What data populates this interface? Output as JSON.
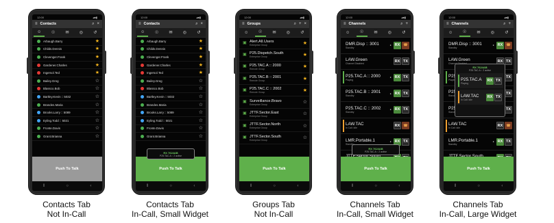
{
  "status_time": "12:00",
  "menu_icon": "menu-icon",
  "search_icon": "search-icon",
  "add_icon": "add-icon",
  "close_icon": "close-icon",
  "tab_icons": [
    "person-icon",
    "radio-icon",
    "message-icon",
    "globe-icon",
    "history-icon"
  ],
  "ptt_label": "Push To Talk",
  "contacts": [
    {
      "name": "Arbaugh.Barry",
      "color": "#4caf50",
      "fav": true
    },
    {
      "name": "Childs.Dennis",
      "color": "#4caf50",
      "fav": true
    },
    {
      "name": "Clevenger.Frank",
      "color": "#4caf50",
      "fav": true
    },
    {
      "name": "Gardener.Charles",
      "color": "#e53935",
      "fav": true
    },
    {
      "name": "Ingersol.Ted",
      "color": "#e53935",
      "fav": true
    },
    {
      "name": "Bailey.Greg",
      "color": "#4caf50",
      "fav": false
    },
    {
      "name": "Blassco.Bob",
      "color": "#e53935",
      "fav": false
    },
    {
      "name": "Bartley.Kevin :: 5032",
      "color": "#42a5f5",
      "fav": false
    },
    {
      "name": "Brandes.Maria",
      "color": "#4caf50",
      "fav": false
    },
    {
      "name": "Brooks.Larry :: 5089",
      "color": "#42a5f5",
      "fav": false
    },
    {
      "name": "Eyling.Todd :: 5021",
      "color": "#42a5f5",
      "fav": false
    },
    {
      "name": "Fronte.Davis",
      "color": "#4caf50",
      "fav": false
    },
    {
      "name": "Grant.Brianna",
      "color": "#4caf50",
      "fav": false
    }
  ],
  "groups": [
    {
      "name": "Alert.All.Users",
      "sub": "Enterprise Group",
      "fav": true
    },
    {
      "name": "P25.Dispetch.South",
      "sub": "Enterprise Group",
      "fav": true
    },
    {
      "name": "P25.TAC.A :: 2000",
      "sub": "Remote Group",
      "fav": true
    },
    {
      "name": "P25.TAC.B :: 2001",
      "sub": "Remote Group",
      "fav": true
    },
    {
      "name": "P25.TAC.C :: 2002",
      "sub": "Remote Group",
      "fav": true
    },
    {
      "name": "Surveillance.Bravo",
      "sub": "Enterprise Group",
      "fav": false
    },
    {
      "name": "JTTF.Sector.East",
      "sub": "Enterprise Group",
      "fav": false
    },
    {
      "name": "JTTF.Sector.North",
      "sub": "Enterprise Group",
      "fav": false
    },
    {
      "name": "JTTF.Sector.South",
      "sub": "Enterprise Group",
      "fav": false
    }
  ],
  "channels": [
    {
      "name": "DMR.Disp :: 3001",
      "status": "Standby",
      "bar": "",
      "rx": "on",
      "mon": "●",
      "emg": true
    },
    {
      "name": "LAW.Green",
      "status": "Channel Disabled",
      "bar": "",
      "rx": "off",
      "mon": "",
      "emg": false
    },
    {
      "name": "P25.TAC.A :: 2000",
      "status": "Playing",
      "bar": "#5fb04b",
      "rx": "on",
      "mon": "●",
      "emg": false
    },
    {
      "name": "P25.TAC.B :: 2001",
      "status": "Standby",
      "bar": "",
      "rx": "on",
      "mon": "●",
      "emg": false
    },
    {
      "name": "P25.TAC.C :: 2002",
      "status": "Standby",
      "bar": "",
      "rx": "on",
      "mon": "●",
      "emg": false
    },
    {
      "name": "LAW.TAC",
      "status": "In Call: Idle",
      "bar": "#f0a030",
      "rx": "off",
      "mon": "",
      "emg": true
    },
    {
      "name": "LMR.Portable.1",
      "status": "Standby",
      "bar": "",
      "rx": "on",
      "mon": "●",
      "emg": false
    },
    {
      "name": "JTTF.Sector.South",
      "status": "Standby",
      "bar": "",
      "rx": "on",
      "mon": "",
      "emg": false
    }
  ],
  "rx_label": "RX",
  "tx_label": "TX",
  "small_widget": {
    "line1": "RX 7624AB",
    "line2": "P25.TAC.A :: 2 active"
  },
  "large_widget": {
    "line1": "RX 7624AB",
    "line2": "P25.TAC.A :: 2 active",
    "rows": [
      {
        "name": "P25.TAC.A",
        "status": "Playing",
        "bar": "#5fb04b"
      },
      {
        "name": "LAW.TAC",
        "status": "In Call: Idle",
        "bar": "#f0a030"
      }
    ]
  },
  "phones": [
    {
      "id": "contacts-idle",
      "title": "Contacts",
      "kind": "contacts",
      "tab": 0,
      "widget": "none",
      "ptt": "grey",
      "icons": [
        "search",
        "close"
      ],
      "caption": [
        "Contacts Tab",
        "Not In-Call"
      ]
    },
    {
      "id": "contacts-call",
      "title": "Contacts",
      "kind": "contacts",
      "tab": 0,
      "widget": "small",
      "ptt": "green",
      "icons": [
        "search",
        "close"
      ],
      "caption": [
        "Contacts Tab",
        "In-Call, Small Widget"
      ]
    },
    {
      "id": "groups-idle",
      "title": "Groups",
      "kind": "groups",
      "tab": 1,
      "widget": "none",
      "ptt": "green",
      "icons": [
        "search",
        "add",
        "close"
      ],
      "caption": [
        "Groups Tab",
        "Not In-Call"
      ]
    },
    {
      "id": "channels-small",
      "title": "Channels",
      "kind": "channels",
      "tab": 1,
      "widget": "small",
      "ptt": "green",
      "icons": [
        "search",
        "add"
      ],
      "caption": [
        "Channels Tab",
        "In-Call, Small Widget"
      ]
    },
    {
      "id": "channels-large",
      "title": "Channels",
      "kind": "channels",
      "tab": 1,
      "widget": "large",
      "ptt": "green",
      "icons": [
        "search",
        "add"
      ],
      "caption": [
        "Channels Tab",
        "In-Call, Large Widget"
      ]
    }
  ]
}
